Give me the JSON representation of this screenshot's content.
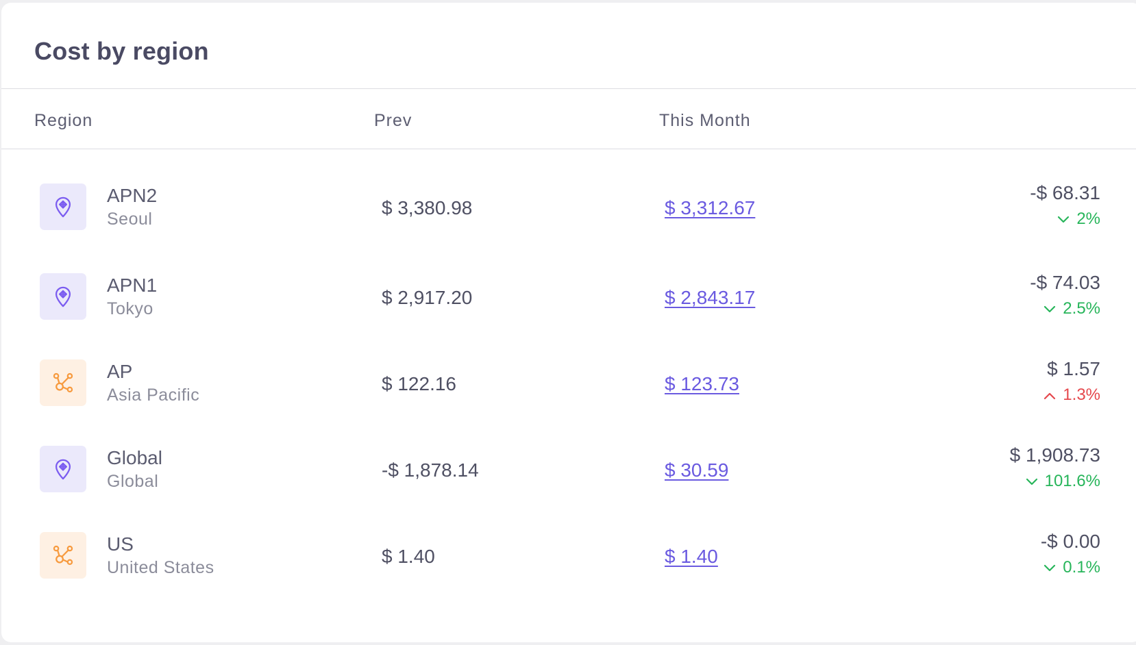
{
  "card": {
    "title": "Cost by region"
  },
  "columns": {
    "region": "Region",
    "prev": "Prev",
    "this_month": "This Month"
  },
  "colors": {
    "accent": "#6a5ae0",
    "pin_icon": "#7b5cf0",
    "hub_icon": "#f79a3e",
    "decrease": "#27b55a",
    "increase": "#e5484d"
  },
  "rows": [
    {
      "icon": "map-pin-icon",
      "code": "APN2",
      "name": "Seoul",
      "prev": "$ 3,380.98",
      "this_month": "$ 3,312.67",
      "diff": "-$ 68.31",
      "pct": "2%",
      "trend": "down"
    },
    {
      "icon": "map-pin-icon",
      "code": "APN1",
      "name": "Tokyo",
      "prev": "$ 2,917.20",
      "this_month": "$ 2,843.17",
      "diff": "-$ 74.03",
      "pct": "2.5%",
      "trend": "down"
    },
    {
      "icon": "network-hub-icon",
      "code": "AP",
      "name": "Asia Pacific",
      "prev": "$ 122.16",
      "this_month": "$ 123.73",
      "diff": "$ 1.57",
      "pct": "1.3%",
      "trend": "up"
    },
    {
      "icon": "map-pin-icon",
      "code": "Global",
      "name": "Global",
      "prev": "-$ 1,878.14",
      "this_month": "$ 30.59",
      "diff": "$ 1,908.73",
      "pct": "101.6%",
      "trend": "down"
    },
    {
      "icon": "network-hub-icon",
      "code": "US",
      "name": "United States",
      "prev": "$ 1.40",
      "this_month": "$ 1.40",
      "diff": "-$ 0.00",
      "pct": "0.1%",
      "trend": "down"
    }
  ]
}
